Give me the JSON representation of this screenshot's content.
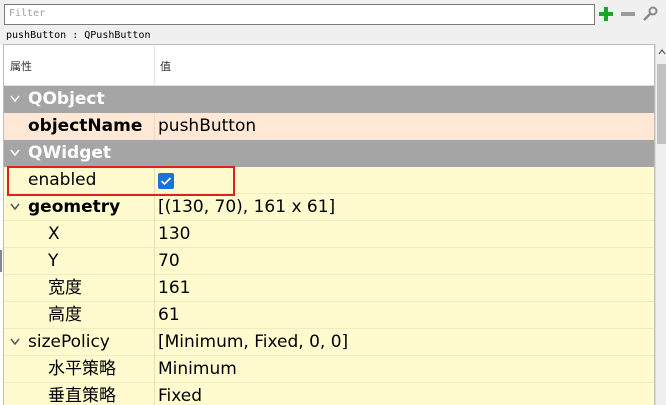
{
  "filter": {
    "placeholder": "Filter"
  },
  "toolbar": {
    "add_icon": "plus-icon",
    "remove_icon": "minus-icon",
    "config_icon": "wrench-icon",
    "add_color": "#1fa51f"
  },
  "object_path": "pushButton : QPushButton",
  "header": {
    "property": "属性",
    "value": "值"
  },
  "groups": {
    "qobject": "QObject",
    "qwidget": "QWidget"
  },
  "props": {
    "objectName": {
      "name": "objectName",
      "value": "pushButton"
    },
    "enabled": {
      "name": "enabled",
      "checked": true
    },
    "geometry": {
      "name": "geometry",
      "value": "[(130, 70), 161 x 61]"
    },
    "x": {
      "name": "X",
      "value": "130"
    },
    "y": {
      "name": "Y",
      "value": "70"
    },
    "width": {
      "name": "宽度",
      "value": "161"
    },
    "height": {
      "name": "高度",
      "value": "61"
    },
    "sizePolicy": {
      "name": "sizePolicy",
      "value": "[Minimum, Fixed, 0, 0]"
    },
    "hPolicy": {
      "name": "水平策略",
      "value": "Minimum"
    },
    "vPolicy": {
      "name": "垂直策略",
      "value": "Fixed"
    }
  },
  "colors": {
    "group_bg": "#a5a5a5",
    "row_bg": "#fffbcf",
    "row_alt_bg": "#ffe8d6",
    "highlight": "#e02020",
    "checkbox": "#1a73d9"
  }
}
